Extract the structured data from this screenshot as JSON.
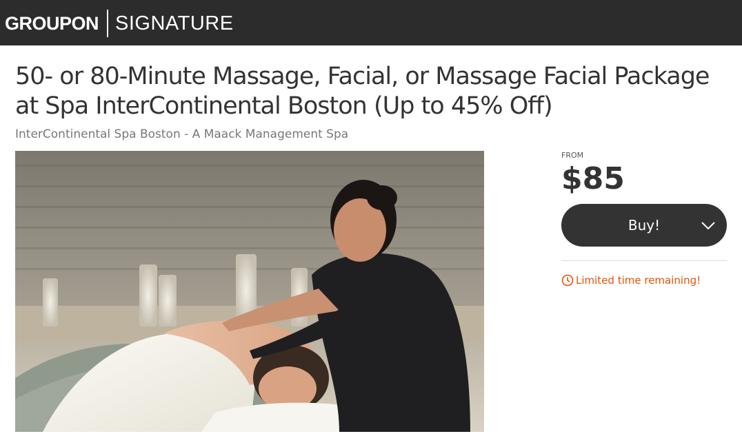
{
  "header": {
    "logo_brand": "GROUPON",
    "logo_product": "SIGNATURE"
  },
  "deal": {
    "title": "50- or 80-Minute Massage, Facial, or Massage Facial Package at Spa InterContinental Boston (Up to 45% Off)",
    "merchant": "InterContinental Spa Boston - A Maack Management Spa",
    "image_subject": "spa-massage-photo"
  },
  "purchase": {
    "from_label": "FROM",
    "price": "$85",
    "buy_label": "Buy!",
    "urgency": "Limited time remaining!"
  },
  "colors": {
    "header_bg": "#2c2c2c",
    "button_bg": "#333333",
    "urgency": "#e35205"
  },
  "icons": [
    "chevron-down-icon",
    "clock-icon"
  ]
}
